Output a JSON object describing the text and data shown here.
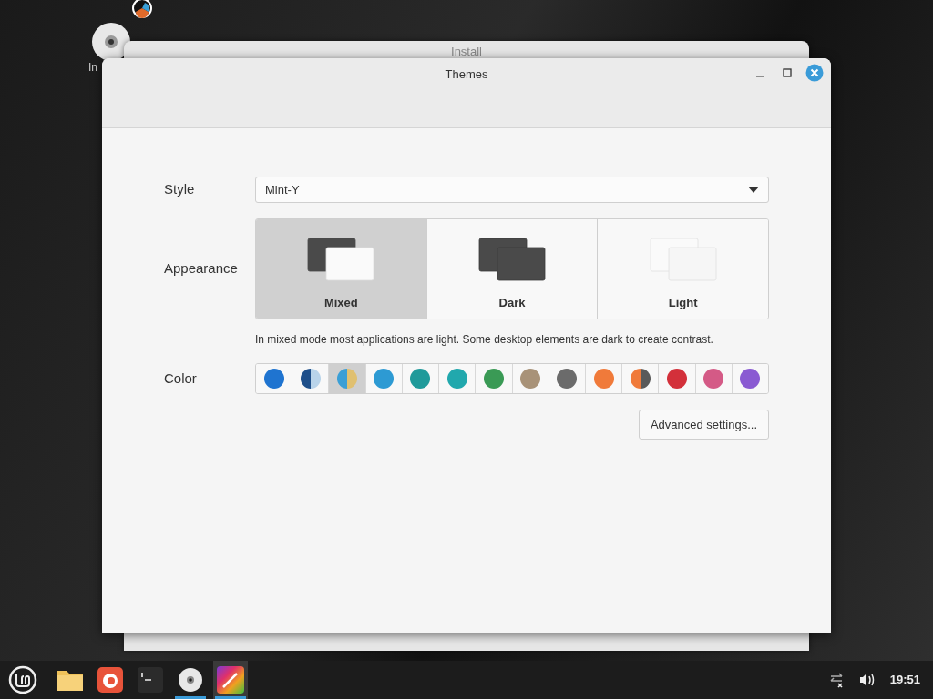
{
  "desktop": {
    "icons": [
      {
        "label": "In"
      }
    ]
  },
  "background_window": {
    "title": "Install"
  },
  "window": {
    "title": "Themes"
  },
  "style": {
    "label": "Style",
    "value": "Mint-Y"
  },
  "appearance": {
    "label": "Appearance",
    "options": [
      {
        "label": "Mixed",
        "kind": "mixed",
        "selected": true
      },
      {
        "label": "Dark",
        "kind": "dark",
        "selected": false
      },
      {
        "label": "Light",
        "kind": "light",
        "selected": false
      }
    ],
    "description": "In mixed mode most applications are light. Some desktop elements are dark to create contrast."
  },
  "color": {
    "label": "Color",
    "swatches": [
      {
        "kind": "solid",
        "color": "#1f74d0",
        "selected": false
      },
      {
        "kind": "split",
        "halves": [
          {
            "color": "#1e4f8a"
          },
          {
            "color": "#b9d4ea"
          }
        ],
        "selected": false
      },
      {
        "kind": "split",
        "halves": [
          {
            "color": "#3a9fd6"
          },
          {
            "color": "#e0c070"
          }
        ],
        "selected": true
      },
      {
        "kind": "solid",
        "color": "#2d9ad3",
        "selected": false
      },
      {
        "kind": "solid",
        "color": "#1f9a9a",
        "selected": false
      },
      {
        "kind": "solid",
        "color": "#21a8ad",
        "selected": false
      },
      {
        "kind": "solid",
        "color": "#3a9a55",
        "selected": false
      },
      {
        "kind": "solid",
        "color": "#a89278",
        "selected": false
      },
      {
        "kind": "solid",
        "color": "#6b6b6b",
        "selected": false
      },
      {
        "kind": "solid",
        "color": "#f07a3a",
        "selected": false
      },
      {
        "kind": "split",
        "halves": [
          {
            "color": "#f07a3a"
          },
          {
            "color": "#5a5a5a"
          }
        ],
        "selected": false
      },
      {
        "kind": "solid",
        "color": "#d3303a",
        "selected": false
      },
      {
        "kind": "solid",
        "color": "#d45a86",
        "selected": false
      },
      {
        "kind": "solid",
        "color": "#8a5ad2",
        "selected": false
      }
    ]
  },
  "advanced_button": "Advanced settings...",
  "taskbar": {
    "apps": [
      {
        "kind": "folder",
        "running": false,
        "focused": false
      },
      {
        "kind": "browser",
        "running": false,
        "focused": false
      },
      {
        "kind": "terminal",
        "running": false,
        "focused": false
      },
      {
        "kind": "disc",
        "running": true,
        "focused": false
      },
      {
        "kind": "themes",
        "running": true,
        "focused": true
      }
    ],
    "clock": "19:51"
  }
}
